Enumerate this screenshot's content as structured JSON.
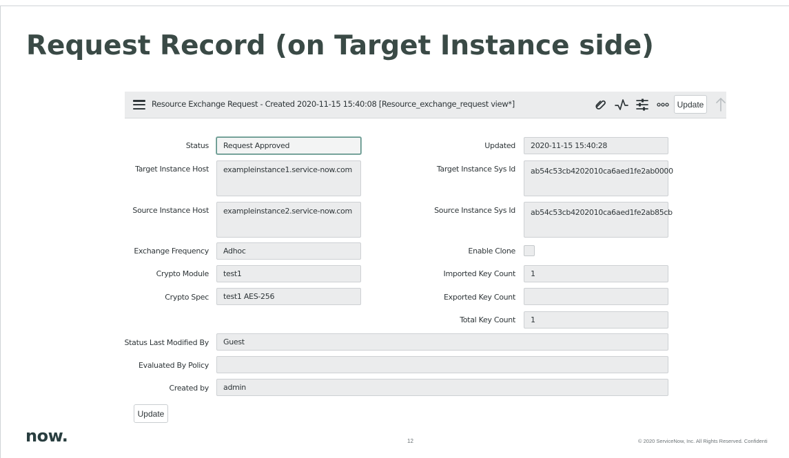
{
  "slide": {
    "title": "Request Record (on Target Instance side)",
    "logo": "now.",
    "page_number": "12",
    "copyright": "© 2020 ServiceNow, Inc. All Rights Reserved. Confidenti"
  },
  "header": {
    "title": "Resource Exchange Request - Created 2020-11-15 15:40:08 [Resource_exchange_request view*]",
    "update_label": "Update",
    "icons": [
      "hamburger-menu-icon",
      "paperclip-icon",
      "activity-icon",
      "settings-sliders-icon",
      "more-options-icon",
      "up-arrow-icon"
    ]
  },
  "form": {
    "left": [
      {
        "label": "Status",
        "value": "Request Approved"
      },
      {
        "label": "Target Instance Host",
        "value": "exampleinstance1.service-now.com"
      },
      {
        "label": "Source Instance Host",
        "value": "exampleinstance2.service-now.com"
      },
      {
        "label": "Exchange Frequency",
        "value": "Adhoc"
      },
      {
        "label": "Crypto Module",
        "value": "test1"
      },
      {
        "label": "Crypto Spec",
        "value": "test1 AES-256"
      }
    ],
    "right": [
      {
        "label": "Updated",
        "value": "2020-11-15 15:40:28"
      },
      {
        "label": "Target Instance Sys Id",
        "value": "ab54c53cb4202010ca6aed1fe2ab0000"
      },
      {
        "label": "Source Instance Sys Id",
        "value": "ab54c53cb4202010ca6aed1fe2ab85cb"
      },
      {
        "label": "Enable Clone",
        "value": ""
      },
      {
        "label": "Imported Key Count",
        "value": "1"
      },
      {
        "label": "Exported Key Count",
        "value": ""
      },
      {
        "label": "Total Key Count",
        "value": "1"
      }
    ],
    "wide": [
      {
        "label": "Status Last Modified By",
        "value": "Guest"
      },
      {
        "label": "Evaluated By Policy",
        "value": ""
      },
      {
        "label": "Created by",
        "value": "admin"
      }
    ],
    "update_label": "Update"
  }
}
